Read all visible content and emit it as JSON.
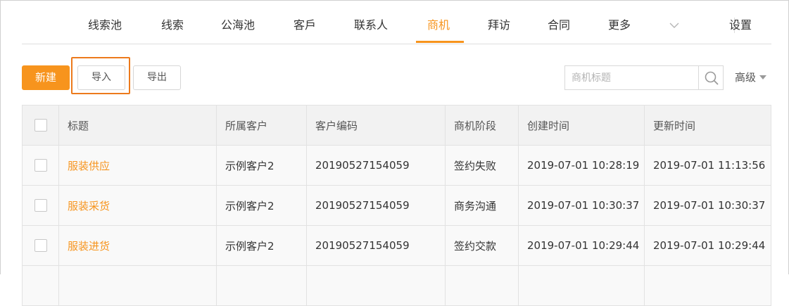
{
  "nav": {
    "items": [
      {
        "label": "线索池"
      },
      {
        "label": "线索"
      },
      {
        "label": "公海池"
      },
      {
        "label": "客戶"
      },
      {
        "label": "联系人"
      },
      {
        "label": "商机"
      },
      {
        "label": "拜访"
      },
      {
        "label": "合同"
      },
      {
        "label": "更多"
      }
    ],
    "active": "商机",
    "settings_label": "设置",
    "more_icon": "chevron-down-icon"
  },
  "toolbar": {
    "new_label": "新建",
    "import_label": "导入",
    "export_label": "导出",
    "search_placeholder": "商机标题",
    "search_icon": "search-icon",
    "advanced_label": "高级",
    "accent_color": "#f7941d",
    "highlight_color": "#ec7a1c"
  },
  "table": {
    "columns": [
      "标题",
      "所属客户",
      "客户编码",
      "商机阶段",
      "创建时间",
      "更新时间"
    ],
    "rows": [
      {
        "title": "服装供应",
        "customer": "示例客户2",
        "code": "20190527154059",
        "stage": "签约失败",
        "created": "2019-07-01 10:28:19",
        "updated": "2019-07-01 11:13:56"
      },
      {
        "title": "服装采货",
        "customer": "示例客户2",
        "code": "20190527154059",
        "stage": "商务沟通",
        "created": "2019-07-01 10:30:37",
        "updated": "2019-07-01 10:30:37"
      },
      {
        "title": "服装进货",
        "customer": "示例客户2",
        "code": "20190527154059",
        "stage": "签约交款",
        "created": "2019-07-01 10:29:44",
        "updated": "2019-07-01 10:29:44"
      }
    ]
  }
}
